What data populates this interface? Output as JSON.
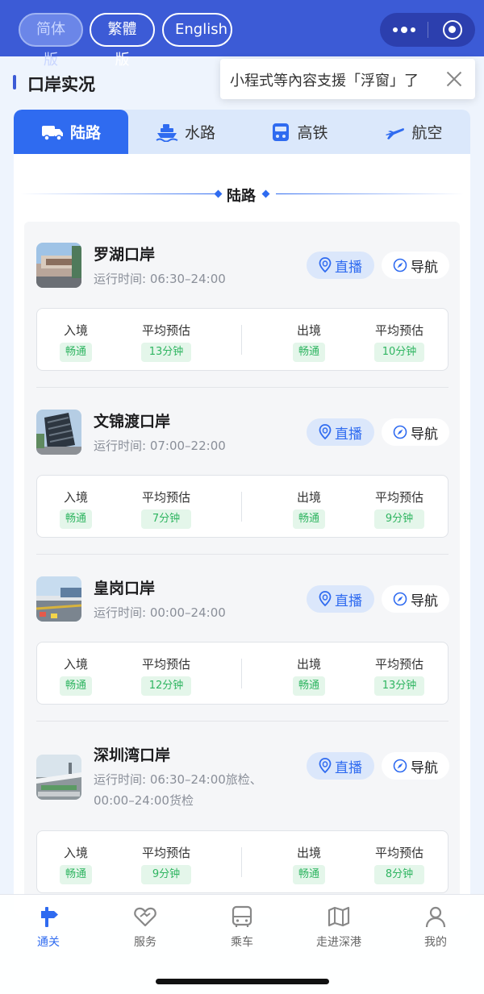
{
  "header": {
    "lang_buttons": [
      {
        "label": "简体版",
        "active": true
      },
      {
        "label": "繁體版",
        "active": false
      },
      {
        "label": "English",
        "active": false
      }
    ]
  },
  "tip": {
    "text": "小程式等內容支援「浮窗」了"
  },
  "section": {
    "title": "口岸实况"
  },
  "tabs": [
    {
      "label": "陆路",
      "icon": "truck-icon",
      "active": true
    },
    {
      "label": "水路",
      "icon": "ship-icon",
      "active": false
    },
    {
      "label": "高铁",
      "icon": "train-icon",
      "active": false
    },
    {
      "label": "航空",
      "icon": "plane-icon",
      "active": false
    }
  ],
  "subheading": "陆路",
  "ports": [
    {
      "name": "罗湖口岸",
      "hours": "运行时间: 06:30–24:00",
      "live_label": "直播",
      "nav_label": "导航",
      "entry_label": "入境",
      "entry_status": "畅通",
      "entry_avg_label": "平均预估",
      "entry_avg": "13分钟",
      "exit_label": "出境",
      "exit_status": "畅通",
      "exit_avg_label": "平均预估",
      "exit_avg": "10分钟"
    },
    {
      "name": "文锦渡口岸",
      "hours": "运行时间: 07:00–22:00",
      "live_label": "直播",
      "nav_label": "导航",
      "entry_label": "入境",
      "entry_status": "畅通",
      "entry_avg_label": "平均预估",
      "entry_avg": "7分钟",
      "exit_label": "出境",
      "exit_status": "畅通",
      "exit_avg_label": "平均预估",
      "exit_avg": "9分钟"
    },
    {
      "name": "皇岗口岸",
      "hours": "运行时间: 00:00–24:00",
      "live_label": "直播",
      "nav_label": "导航",
      "entry_label": "入境",
      "entry_status": "畅通",
      "entry_avg_label": "平均预估",
      "entry_avg": "12分钟",
      "exit_label": "出境",
      "exit_status": "畅通",
      "exit_avg_label": "平均预估",
      "exit_avg": "13分钟"
    },
    {
      "name": "深圳湾口岸",
      "hours": "运行时间: 06:30–24:00旅检、00:00–24:00货检",
      "live_label": "直播",
      "nav_label": "导航",
      "entry_label": "入境",
      "entry_status": "畅通",
      "entry_avg_label": "平均预估",
      "entry_avg": "9分钟",
      "exit_label": "出境",
      "exit_status": "畅通",
      "exit_avg_label": "平均预估",
      "exit_avg": "8分钟"
    }
  ],
  "tabbar": [
    {
      "label": "通关",
      "icon": "customs-icon",
      "active": true
    },
    {
      "label": "服务",
      "icon": "heart-hand-icon",
      "active": false
    },
    {
      "label": "乘车",
      "icon": "bus-icon",
      "active": false
    },
    {
      "label": "走进深港",
      "icon": "map-icon",
      "active": false
    },
    {
      "label": "我的",
      "icon": "user-icon",
      "active": false
    }
  ],
  "colors": {
    "header_bg": "#3c5bd6",
    "accent": "#2f6bf0",
    "status_green": "#2fb561",
    "status_green_bg": "#e4f6ea"
  }
}
